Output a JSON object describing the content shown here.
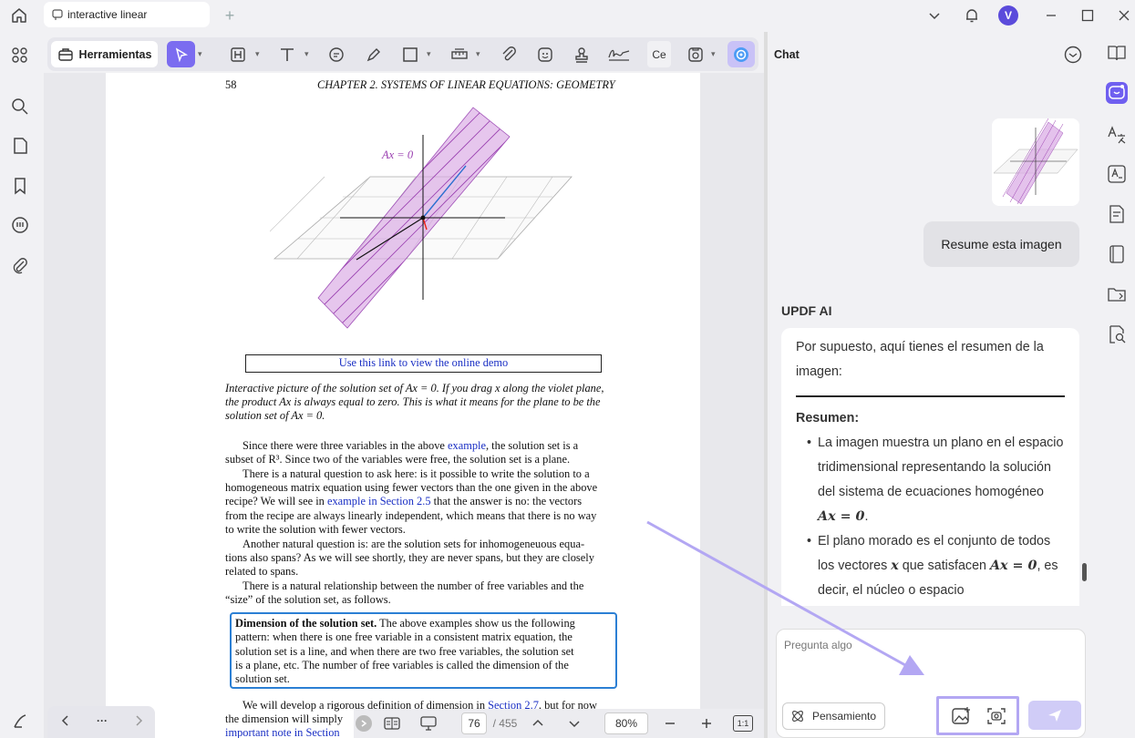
{
  "tab": {
    "title": "interactive linear"
  },
  "window": {
    "avatar_letter": "V"
  },
  "toolbar": {
    "tools_label": "Herramientas",
    "truncated_label": "Ce"
  },
  "page": {
    "number": "58",
    "header": "CHAPTER 2.  SYSTEMS OF LINEAR EQUATIONS: GEOMETRY",
    "figure_label": "Ax = 0",
    "demo_link": "Use this link to view the online demo",
    "caption_1": "Interactive picture of the solution set of Ax = 0. If you drag x along the violet plane,",
    "caption_2": "the product Ax is always equal to zero. This is what it means for the plane to be the",
    "caption_3": "solution set of Ax = 0.",
    "p1_a": "Since there were three variables in the above ",
    "p1_link": "example",
    "p1_b": ", the solution set is a",
    "p1_c": "subset of R³. Since two of the variables were free, the solution set is a plane.",
    "p2_1": "There is a natural question to ask here: is it possible to write the solution to a",
    "p2_2": "homogeneous matrix equation using fewer vectors than the one given in the above",
    "p2_3a": "recipe? We will see in ",
    "p2_3link": "example in Section 2.5",
    "p2_3b": " that the answer is no: the vectors",
    "p2_4": "from the recipe are always linearly independent, which means that there is no way",
    "p2_5": "to write the solution with fewer vectors.",
    "p3_1": "Another natural question is: are the solution sets for inhomogeneuous equa-",
    "p3_2": "tions also spans? As we will see shortly, they are never spans, but they are closely",
    "p3_3": "related to spans.",
    "p4_1": "There is a natural relationship between the number of free variables and the",
    "p4_2": "“size” of the solution set, as follows.",
    "box_bold": "Dimension of the solution set.",
    "box_1": " The above examples show us the following",
    "box_2": "pattern: when there is one free variable in a consistent matrix equation, the",
    "box_3": "solution set is a line, and when there are two free variables, the solution set",
    "box_4": "is a plane, etc. The number of free variables is called the dimension of the",
    "box_5": "solution set.",
    "p5_1a": "We will develop a rigorous definition of dimension in ",
    "p5_1link": "Section 2.7",
    "p5_1b": ", but for now",
    "p5_2": "the dimension will simply",
    "p5_3link": "important note in Section"
  },
  "nav": {
    "current_page": "76",
    "total_pages": "/ 455",
    "zoom": "80%",
    "fit_label": "1:1"
  },
  "chat": {
    "title": "Chat",
    "user_message": "Resume esta imagen",
    "ai_name": "UPDF AI",
    "ai_intro": "Por supuesto, aquí tienes el resumen de la imagen:",
    "ai_heading": "Resumen:",
    "b1_text": "La imagen muestra un plano en el espacio tridimensional representando la solución del sistema de ecuaciones homogéneo ",
    "b1_math": "Ax = 0",
    "b1_end": ".",
    "b2_a": "El plano morado es el conjunto de todos los vectores ",
    "b2_math1": "x",
    "b2_b": " que satisfacen ",
    "b2_math2": "Ax = 0",
    "b2_c": ", es decir, el núcleo o espacio",
    "input_placeholder": "Pregunta algo",
    "thinking_label": "Pensamiento"
  },
  "colors": {
    "accent": "#7b6cf0",
    "plane": "#c77fd6",
    "highlight": "#b3a7f3",
    "link": "#1a2fc4"
  }
}
